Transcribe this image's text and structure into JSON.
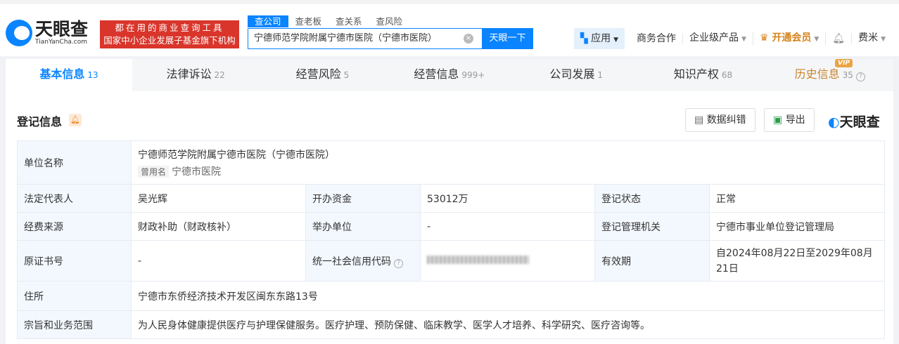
{
  "header": {
    "logo_cn": "天眼查",
    "logo_en": "TianYanCha.com",
    "slogan1": "都在用的商业查询工具",
    "slogan2": "国家中小企业发展子基金旗下机构",
    "search_tabs": [
      "查公司",
      "查老板",
      "查关系",
      "查风险"
    ],
    "search_value": "宁德师范学院附属宁德市医院（宁德市医院）",
    "search_button": "天眼一下",
    "nav": {
      "app": "应用",
      "business": "商务合作",
      "enterprise": "企业级产品",
      "vip": "开通会员",
      "user": "费米"
    }
  },
  "tabs": [
    {
      "label": "基本信息",
      "count": "13"
    },
    {
      "label": "法律诉讼",
      "count": "22"
    },
    {
      "label": "经营风险",
      "count": "5"
    },
    {
      "label": "经营信息",
      "count": "999+"
    },
    {
      "label": "公司发展",
      "count": "1"
    },
    {
      "label": "知识产权",
      "count": "68"
    },
    {
      "label": "历史信息",
      "count": "35"
    }
  ],
  "vip_badge": "VIP",
  "section": {
    "title": "登记信息",
    "correct_button": "数据纠错",
    "export_button": "导出",
    "brand": "天眼查"
  },
  "info": {
    "unit_name_label": "单位名称",
    "unit_name": "宁德师范学院附属宁德市医院（宁德市医院）",
    "former_tag": "曾用名",
    "former_name": "宁德市医院",
    "legal_rep_label": "法定代表人",
    "legal_rep": "吴光辉",
    "capital_label": "开办资金",
    "capital": "53012万",
    "status_label": "登记状态",
    "status": "正常",
    "fund_label": "经费来源",
    "fund": "财政补助（财政核补）",
    "sponsor_label": "举办单位",
    "sponsor": "-",
    "authority_label": "登记管理机关",
    "authority": "宁德市事业单位登记管理局",
    "cert_label": "原证书号",
    "cert": "-",
    "credit_label": "统一社会信用代码",
    "validity_label": "有效期",
    "validity": "自2024年08月22日至2029年08月21日",
    "address_label": "住所",
    "address": "宁德市东侨经济技术开发区闽东东路13号",
    "scope_label": "宗旨和业务范围",
    "scope": "为人民身体健康提供医疗与护理保健服务。医疗护理、预防保健、临床教学、医学人才培养、科学研究、医疗咨询等。"
  }
}
